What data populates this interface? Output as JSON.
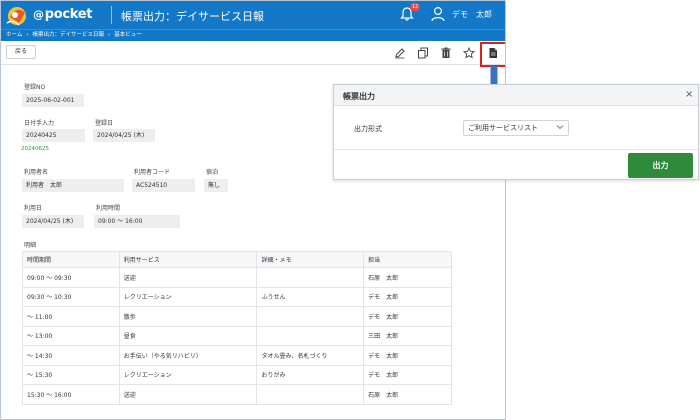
{
  "header": {
    "brand": "pocket",
    "brand_at": "@",
    "title": "帳票出力：デイサービス日報",
    "notification_count": "12",
    "user_name": "デモ　太郎",
    "color": "#1478c8"
  },
  "breadcrumb": {
    "items": [
      "ホーム",
      "帳票出力：デイサービス日報",
      "基本ビュー"
    ],
    "separator": "›"
  },
  "toolbar": {
    "back_label": "戻る",
    "icons": [
      "edit-icon",
      "copy-icon",
      "trash-icon",
      "star-icon",
      "document-export-icon"
    ]
  },
  "form": {
    "reg_no_label": "登録NO",
    "reg_no_value": "2025-06-02-001",
    "date_input_label": "日付手入力",
    "date_input_value": "20240425",
    "reg_date_label": "登録日",
    "reg_date_value": "2024/04/25 (木)",
    "green_note": "20240625",
    "user_name_label": "利用者名",
    "user_name_value": "利用者　太郎",
    "user_code_label": "利用者コード",
    "user_code_value": "AC524510",
    "stay_label": "宿泊",
    "stay_value": "無し",
    "use_date_label": "利用日",
    "use_date_value": "2024/04/25 (木)",
    "use_time_label": "利用時間",
    "use_time_value": "09:00 〜 16:00",
    "detail_label": "明細"
  },
  "table": {
    "headers": [
      "時間期間",
      "利用サービス",
      "詳細・メモ",
      "担当"
    ],
    "rows": [
      [
        "09:00 〜 09:30",
        "送迎",
        "",
        "石原　太郎"
      ],
      [
        "09:30 〜 10:30",
        "レクリエーション",
        "ふうせん",
        "デモ　太郎"
      ],
      [
        "〜 11:00",
        "散歩",
        "",
        "デモ　太郎"
      ],
      [
        "〜 13:00",
        "昼食",
        "",
        "三田　太郎"
      ],
      [
        "〜 14:30",
        "お手伝い（やる気リハビリ）",
        "タオル畳み、名札づくり",
        "デモ　太郎"
      ],
      [
        "〜 15:30",
        "レクリエーション",
        "おりがみ",
        "デモ　太郎"
      ],
      [
        "15:30 〜 16:00",
        "送迎",
        "",
        "石原　太郎"
      ]
    ]
  },
  "modal": {
    "title": "帳票出力",
    "close": "×",
    "format_label": "出力形式",
    "format_value": "ご利用サービスリスト",
    "output_button": "出力",
    "button_color": "#2e8b3c"
  },
  "annotation": {
    "highlight_color": "#e0201c",
    "arrow_color": "#3a72c4"
  }
}
